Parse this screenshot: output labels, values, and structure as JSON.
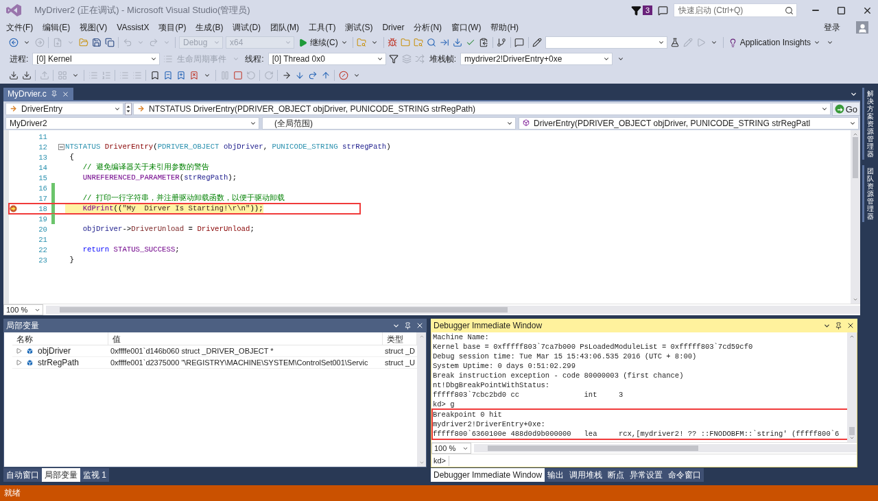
{
  "window": {
    "title": "MyDriver2 (正在调试) - Microsoft Visual Studio(管理员)",
    "notification_count": "3",
    "quick_launch": {
      "placeholder": "快速启动 (Ctrl+Q)"
    }
  },
  "menu": {
    "items": [
      "文件(F)",
      "编辑(E)",
      "视图(V)",
      "VAssistX",
      "项目(P)",
      "生成(B)",
      "调试(D)",
      "团队(M)",
      "工具(T)",
      "测试(S)",
      "Driver",
      "分析(N)",
      "窗口(W)",
      "帮助(H)"
    ],
    "sign_in": "登录"
  },
  "toolbars": [
    {
      "items": [
        {
          "kind": "icon",
          "disabled": false
        },
        {
          "kind": "icon",
          "disabled": false
        },
        {
          "kind": "icon",
          "disabled": true
        },
        {
          "kind": "separator"
        },
        {
          "kind": "icon",
          "disabled": true
        },
        {
          "kind": "icon",
          "disabled": true
        },
        {
          "kind": "icon",
          "disabled": false
        },
        {
          "kind": "icon",
          "disabled": false
        },
        {
          "kind": "icon",
          "disabled": false
        },
        {
          "kind": "separator"
        },
        {
          "kind": "icon",
          "disabled": true
        },
        {
          "kind": "icon",
          "disabled": true
        },
        {
          "kind": "icon",
          "disabled": true
        },
        {
          "kind": "icon",
          "disabled": true
        },
        {
          "kind": "separator"
        },
        {
          "kind": "combo",
          "value": "Debug",
          "disabled": true
        },
        {
          "kind": "combo",
          "value": "x64",
          "disabled": true
        },
        {
          "kind": "button",
          "label": "继续(C)"
        },
        {
          "kind": "separator"
        },
        {
          "kind": "icon",
          "disabled": false
        },
        {
          "kind": "icon",
          "disabled": false
        },
        {
          "kind": "separator"
        },
        {
          "kind": "icon",
          "disabled": false
        },
        {
          "kind": "icon",
          "disabled": false
        },
        {
          "kind": "icon",
          "disabled": false
        },
        {
          "kind": "icon",
          "disabled": false
        },
        {
          "kind": "icon",
          "disabled": false
        },
        {
          "kind": "icon",
          "disabled": false
        },
        {
          "kind": "icon",
          "disabled": false
        },
        {
          "kind": "icon",
          "disabled": false
        },
        {
          "kind": "separator"
        },
        {
          "kind": "icon",
          "disabled": false
        },
        {
          "kind": "separator"
        },
        {
          "kind": "icon",
          "disabled": false
        },
        {
          "kind": "separator"
        },
        {
          "kind": "icon",
          "disabled": false
        },
        {
          "kind": "combo"
        },
        {
          "kind": "icon",
          "disabled": false
        },
        {
          "kind": "icon",
          "disabled": true
        },
        {
          "kind": "icon",
          "disabled": true
        },
        {
          "kind": "icon",
          "disabled": false
        },
        {
          "kind": "separator"
        },
        {
          "kind": "button",
          "label": "Application Insights"
        },
        {
          "kind": "icon",
          "disabled": false
        }
      ]
    },
    {
      "items": [
        {
          "kind": "label",
          "text": "进程:",
          "disabled": false
        },
        {
          "kind": "combo",
          "value": "[0] Kernel",
          "disabled": false
        },
        {
          "kind": "icon",
          "disabled": true
        },
        {
          "kind": "label",
          "text": "生命周期事件",
          "disabled": true
        },
        {
          "kind": "icon",
          "disabled": true
        },
        {
          "kind": "label",
          "text": "线程:",
          "disabled": false
        },
        {
          "kind": "combo",
          "value": "[0] Thread 0x0",
          "disabled": false
        },
        {
          "kind": "icon",
          "disabled": false
        },
        {
          "kind": "icon",
          "disabled": true
        },
        {
          "kind": "icon",
          "disabled": true
        },
        {
          "kind": "label",
          "text": "堆栈帧:",
          "disabled": false
        },
        {
          "kind": "combo",
          "value": "mydriver2!DriverEntry+0xe",
          "disabled": false
        },
        {
          "kind": "icon",
          "disabled": false
        }
      ]
    },
    {
      "items": [
        {
          "kind": "icon",
          "disabled": false
        },
        {
          "kind": "icon",
          "disabled": false
        },
        {
          "kind": "separator"
        },
        {
          "kind": "icon",
          "disabled": true
        },
        {
          "kind": "separator"
        },
        {
          "kind": "icon",
          "disabled": true
        },
        {
          "kind": "icon",
          "disabled": false
        },
        {
          "kind": "separator"
        },
        {
          "kind": "icon",
          "disabled": true
        },
        {
          "kind": "icon",
          "disabled": true
        },
        {
          "kind": "separator"
        },
        {
          "kind": "icon",
          "disabled": true
        },
        {
          "kind": "icon",
          "disabled": true
        },
        {
          "kind": "separator"
        },
        {
          "kind": "icon",
          "disabled": false
        },
        {
          "kind": "icon",
          "disabled": false
        },
        {
          "kind": "icon",
          "disabled": false
        },
        {
          "kind": "icon",
          "disabled": false
        },
        {
          "kind": "icon",
          "disabled": false
        },
        {
          "kind": "separator"
        },
        {
          "kind": "icon",
          "disabled": true
        },
        {
          "kind": "icon",
          "disabled": false
        },
        {
          "kind": "icon",
          "disabled": true
        },
        {
          "kind": "separator"
        },
        {
          "kind": "icon",
          "disabled": true
        },
        {
          "kind": "separator"
        },
        {
          "kind": "icon",
          "disabled": false
        },
        {
          "kind": "icon",
          "disabled": false
        },
        {
          "kind": "icon",
          "disabled": false
        },
        {
          "kind": "icon",
          "disabled": false
        },
        {
          "kind": "separator"
        },
        {
          "kind": "icon",
          "disabled": false
        },
        {
          "kind": "icon",
          "disabled": false
        }
      ]
    }
  ],
  "document_tabs": [
    {
      "label": "MyDrvier.c",
      "selected": true
    }
  ],
  "navigation": {
    "scope": "DriverEntry",
    "signature": "NTSTATUS DriverEntry(PDRIVER_OBJECT objDriver, PUNICODE_STRING strRegPath)",
    "go": "Go",
    "project": "MyDriver2",
    "range": "(全局范围)",
    "member": "DriverEntry(PDRIVER_OBJECT objDriver, PUNICODE_STRING strRegPatl"
  },
  "editor": {
    "zoom": "100 %",
    "lines": [
      {
        "number": "11",
        "current": false,
        "changed": false,
        "foldable": false,
        "highlighted": false
      },
      {
        "number": "12",
        "current": false,
        "changed": false,
        "foldable": true,
        "highlighted": false,
        "tokens": [
          {
            "text": "NTSTATUS",
            "kind": "type"
          },
          {
            "text": " DriverEntry",
            "kind": "function"
          },
          {
            "text": "(",
            "kind": "plain"
          },
          {
            "text": "PDRIVER_OBJECT",
            "kind": "type"
          },
          {
            "text": " objDriver",
            "kind": "param"
          },
          {
            "text": ", ",
            "kind": "plain"
          },
          {
            "text": "PUNICODE_STRING",
            "kind": "type"
          },
          {
            "text": " strRegPath",
            "kind": "param"
          },
          {
            "text": ")",
            "kind": "plain"
          }
        ]
      },
      {
        "number": "13",
        "current": false,
        "changed": false,
        "foldable": false,
        "highlighted": false,
        "tokens": [
          {
            "text": " {",
            "kind": "plain"
          }
        ]
      },
      {
        "number": "14",
        "current": false,
        "changed": false,
        "foldable": false,
        "highlighted": false,
        "tokens": [
          {
            "text": "    // 避免编译器关于未引用参数的警告",
            "kind": "comment"
          }
        ]
      },
      {
        "number": "15",
        "current": false,
        "changed": false,
        "foldable": false,
        "highlighted": false,
        "tokens": [
          {
            "text": "    UNREFERENCED_PARAMETER",
            "kind": "macro"
          },
          {
            "text": "(",
            "kind": "plain"
          },
          {
            "text": "strRegPath",
            "kind": "param"
          },
          {
            "text": ");",
            "kind": "plain"
          }
        ]
      },
      {
        "number": "16",
        "current": false,
        "changed": true,
        "foldable": false,
        "highlighted": false
      },
      {
        "number": "17",
        "current": false,
        "changed": true,
        "foldable": false,
        "highlighted": false,
        "tokens": [
          {
            "text": "    // 打印一行字符串，并注册驱动卸载函数，以便于驱动卸载",
            "kind": "comment"
          }
        ]
      },
      {
        "number": "18",
        "current": true,
        "changed": true,
        "foldable": false,
        "highlighted": true,
        "tokens": [
          {
            "text": "    KdPrint",
            "kind": "macro"
          },
          {
            "text": "((",
            "kind": "plain"
          },
          {
            "text": "\"My  Dirver Is Starting!\\r\\n\"",
            "kind": "string"
          },
          {
            "text": "));",
            "kind": "plain"
          }
        ]
      },
      {
        "number": "19",
        "current": false,
        "changed": true,
        "foldable": false,
        "highlighted": false
      },
      {
        "number": "20",
        "current": false,
        "changed": false,
        "foldable": false,
        "highlighted": false,
        "tokens": [
          {
            "text": "    objDriver",
            "kind": "param"
          },
          {
            "text": "->",
            "kind": "plain"
          },
          {
            "text": "DriverUnload",
            "kind": "member"
          },
          {
            "text": " = ",
            "kind": "plain"
          },
          {
            "text": "DriverUnload",
            "kind": "function"
          },
          {
            "text": ";",
            "kind": "plain"
          }
        ]
      },
      {
        "number": "21",
        "current": false,
        "changed": false,
        "foldable": false,
        "highlighted": false
      },
      {
        "number": "22",
        "current": false,
        "changed": false,
        "foldable": false,
        "highlighted": false,
        "tokens": [
          {
            "text": "    return",
            "kind": "keyword"
          },
          {
            "text": " STATUS_SUCCESS",
            "kind": "macro"
          },
          {
            "text": ";",
            "kind": "plain"
          }
        ]
      },
      {
        "number": "23",
        "current": false,
        "changed": false,
        "foldable": false,
        "highlighted": false,
        "tokens": [
          {
            "text": " }",
            "kind": "plain"
          }
        ]
      }
    ]
  },
  "side_tabs": [
    "解决方案资源管理器",
    "团队资源管理器"
  ],
  "locals": {
    "title": "局部变量",
    "active": false,
    "columns": [
      "名称",
      "值",
      "类型"
    ],
    "rows": [
      {
        "name": "objDriver",
        "value": "0xffffe001`d146b060 struct _DRIVER_OBJECT *",
        "type": "struct _D",
        "expanded": false
      },
      {
        "name": "strRegPath",
        "value": "0xffffe001`d2375000 \"\\REGISTRY\\MACHINE\\SYSTEM\\ControlSet001\\Servic",
        "type": "struct _U",
        "expanded": false
      }
    ],
    "tabs": [
      {
        "label": "自动窗口",
        "selected": false
      },
      {
        "label": "局部变量",
        "selected": true
      },
      {
        "label": "监视 1",
        "selected": false
      }
    ]
  },
  "immediate": {
    "title": "Debugger Immediate Window",
    "active": true,
    "lines": [
      {
        "text": "Machine Name:",
        "highlighted": false
      },
      {
        "text": "Kernel base = 0xfffff803`7ca7b000 PsLoadedModuleList = 0xfffff803`7cd59cf0",
        "highlighted": false
      },
      {
        "text": "Debug session time: Tue Mar 15 15:43:06.535 2016 (UTC + 8:00)",
        "highlighted": false
      },
      {
        "text": "System Uptime: 0 days 0:51:02.299",
        "highlighted": false
      },
      {
        "text": "Break instruction exception - code 80000003 (first chance)",
        "highlighted": false
      },
      {
        "text": "nt!DbgBreakPointWithStatus:",
        "highlighted": false
      },
      {
        "text": "fffff803`7cbc2bd0 cc               int     3",
        "highlighted": false
      },
      {
        "text": "kd> g",
        "highlighted": false
      },
      {
        "text": "Breakpoint 0 hit",
        "highlighted": true
      },
      {
        "text": "mydriver2!DriverEntry+0xe:",
        "highlighted": true
      },
      {
        "text": "fffff800`6360100e 488d0d9b000000   lea     rcx,[mydriver2! ?? ::FNODOBFM::`string' (fffff800`6",
        "highlighted": true
      }
    ],
    "zoom": "100 %",
    "prompt": "kd>",
    "tabs": [
      {
        "label": "Debugger Immediate Window",
        "selected": true
      },
      {
        "label": "输出",
        "selected": false
      },
      {
        "label": "调用堆栈",
        "selected": false
      },
      {
        "label": "断点",
        "selected": false
      },
      {
        "label": "异常设置",
        "selected": false
      },
      {
        "label": "命令窗口",
        "selected": false
      }
    ]
  },
  "status_bar": {
    "text": "就绪"
  }
}
